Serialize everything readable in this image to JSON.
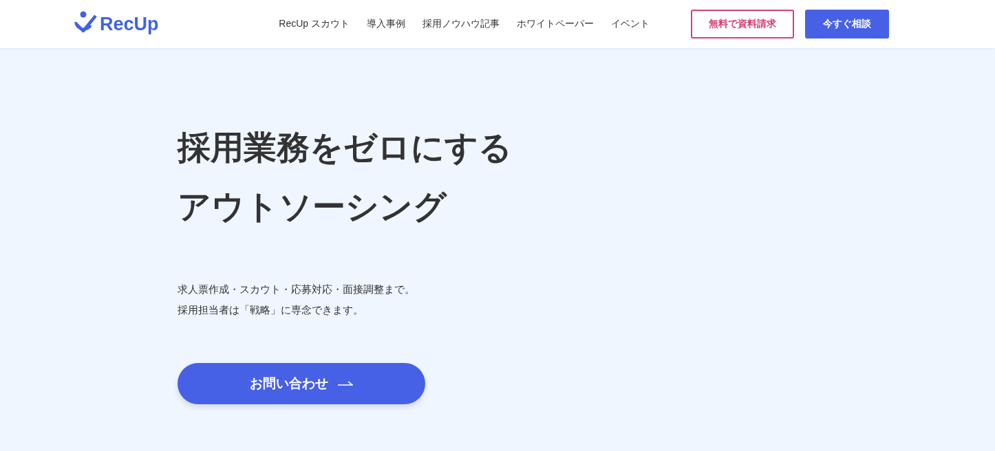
{
  "header": {
    "logo": "RecUp",
    "nav": [
      {
        "label": "RecUp スカウト"
      },
      {
        "label": "導入事例"
      },
      {
        "label": "採用ノウハウ記事"
      },
      {
        "label": "ホワイトペーパー"
      },
      {
        "label": "イベント"
      }
    ],
    "buttons": [
      {
        "kind": "outline",
        "label": "無料で資料請求"
      },
      {
        "kind": "solid",
        "label": "今すぐ相談"
      }
    ]
  },
  "hero": {
    "title_lines": [
      "採用業務をゼロにする",
      "アウトソーシング"
    ],
    "description": [
      "求人票作成・スカウト・応募対応・面接調整まで。",
      "採用担当者は「戦略」に専念できます。"
    ],
    "cta": "お問い合わせ"
  }
}
